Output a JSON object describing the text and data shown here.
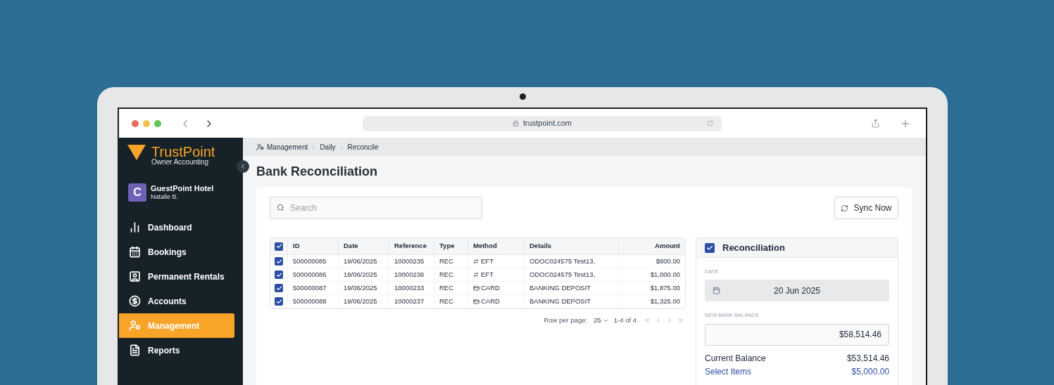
{
  "browser": {
    "url": "trustpoint.com"
  },
  "sidebar": {
    "brand": {
      "name": "TrustPoint",
      "subtitle": "Owner Accounting"
    },
    "account": {
      "initial": "C",
      "name": "GuestPoint Hotel",
      "user": "Natalie B."
    },
    "items": [
      {
        "kind": "dashboard",
        "label": "Dashboard",
        "selected": false
      },
      {
        "kind": "bookings",
        "label": "Bookings",
        "selected": false
      },
      {
        "kind": "rentals",
        "label": "Permanent Rentals",
        "selected": false
      },
      {
        "kind": "accounts",
        "label": "Accounts",
        "selected": false
      },
      {
        "kind": "management",
        "label": "Management",
        "selected": true
      },
      {
        "kind": "reports",
        "label": "Reports",
        "selected": false
      }
    ]
  },
  "breadcrumb": [
    "Management",
    "Daily",
    "Reconcile"
  ],
  "title": "Bank Reconciliation",
  "search": {
    "placeholder": "Search"
  },
  "sync_button": "Sync Now",
  "table": {
    "all_checked": true,
    "columns": [
      "ID",
      "Date",
      "Reference",
      "Type",
      "Method",
      "Details",
      "Amount"
    ],
    "rows": [
      {
        "checked": true,
        "id": "500000085",
        "date": "19/06/2025",
        "reference": "10000235",
        "type": "REC",
        "kind": "eft",
        "method": "EFT",
        "details": "ODOC024575 Test13,",
        "amount": "$800.00"
      },
      {
        "checked": true,
        "id": "500000086",
        "date": "19/06/2025",
        "reference": "10000236",
        "type": "REC",
        "kind": "eft",
        "method": "EFT",
        "details": "ODOC024575 Test13,",
        "amount": "$1,000.00"
      },
      {
        "checked": true,
        "id": "500000087",
        "date": "19/06/2025",
        "reference": "10000233",
        "type": "REC",
        "kind": "card",
        "method": "CARD",
        "details": "BANKING DEPOSIT",
        "amount": "$1,875.00"
      },
      {
        "checked": true,
        "id": "500000088",
        "date": "19/06/2025",
        "reference": "10000237",
        "type": "REC",
        "kind": "card",
        "method": "CARD",
        "details": "BANKING DEPOSIT",
        "amount": "$1,325.00"
      }
    ]
  },
  "pagination": {
    "rows_per_page_label": "Row per page:",
    "rows_per_page": "25",
    "range": "1-4 of 4"
  },
  "reconciliation": {
    "checked": true,
    "title": "Reconciliation",
    "date_label": "DATE",
    "date": "20 Jun 2025",
    "balance_label": "NEW BANK BALANCE",
    "balance": "$58,514.46",
    "summary": [
      {
        "kind": "plain",
        "label": "Current Balance",
        "value": "$53,514.46"
      },
      {
        "kind": "link",
        "label": "Select Items",
        "value": "$5,000.00"
      }
    ]
  }
}
